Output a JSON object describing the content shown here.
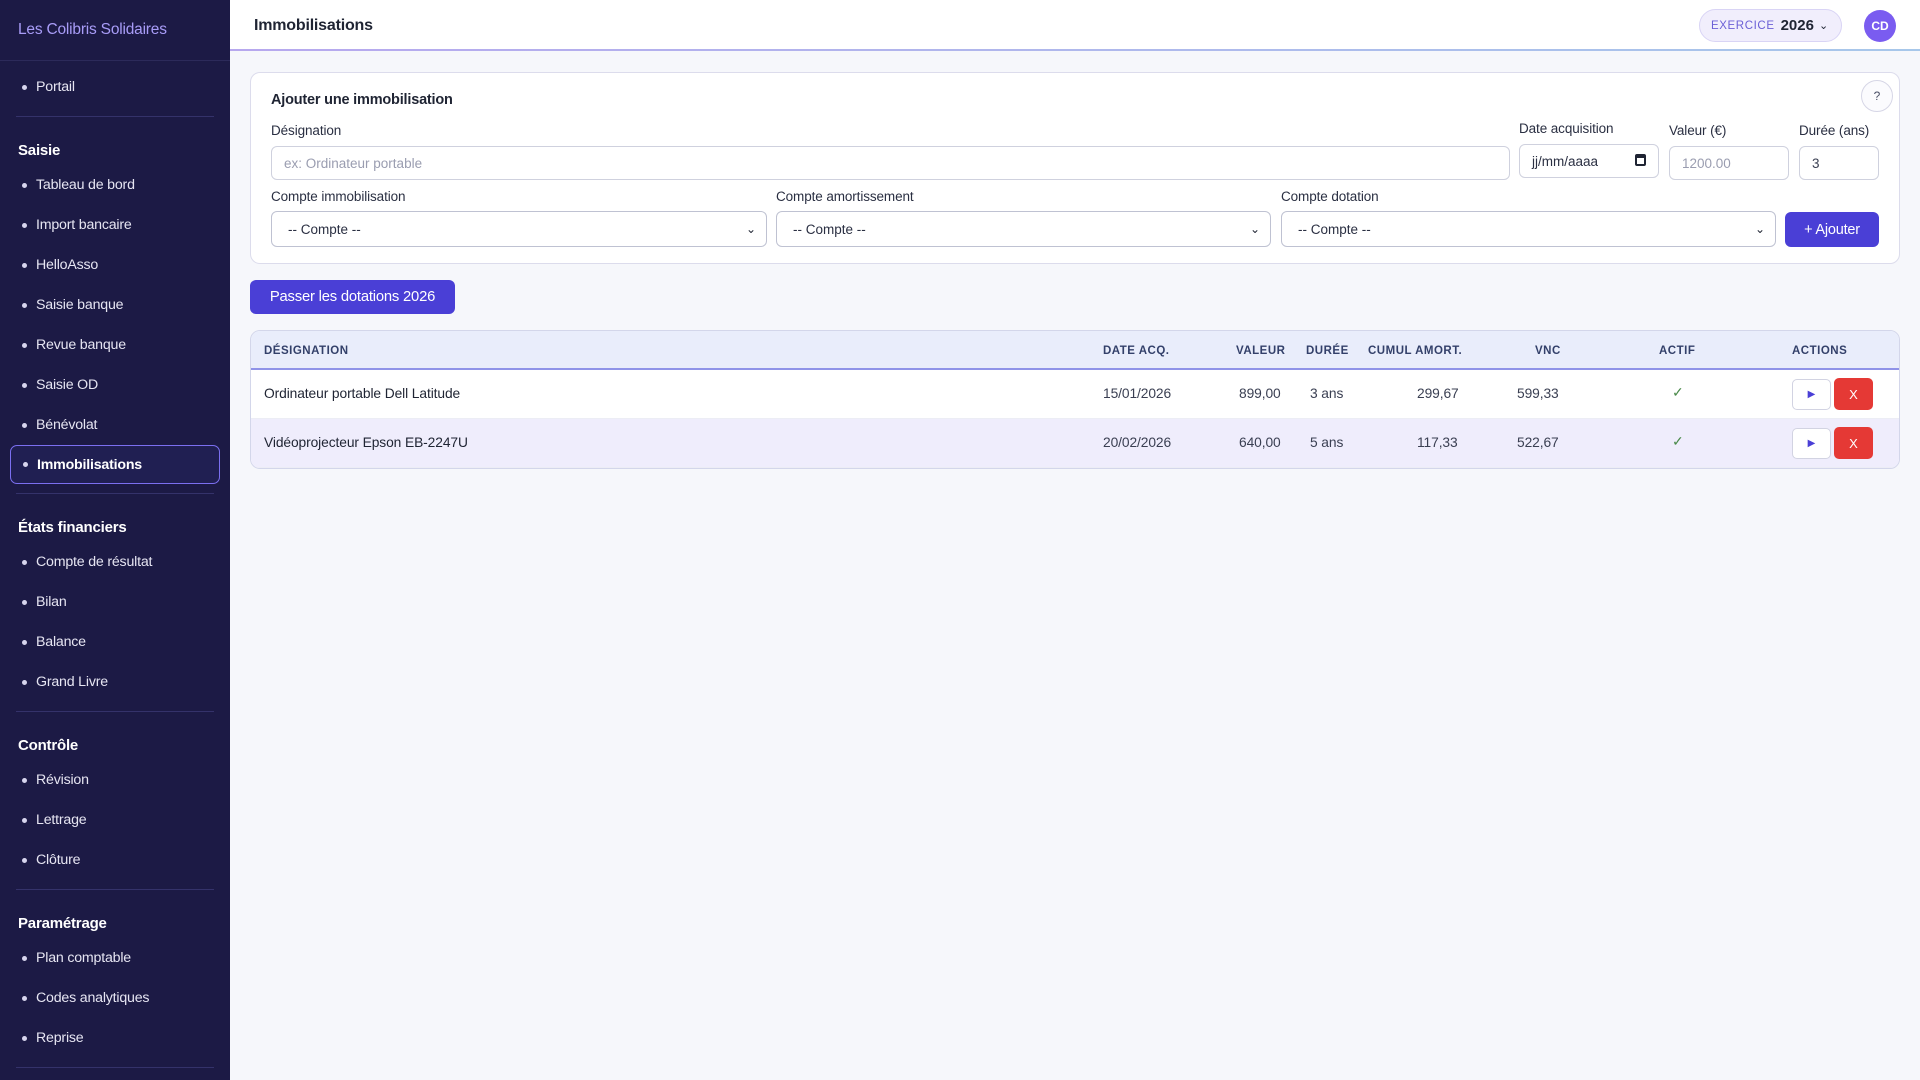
{
  "app": {
    "org_name": "Les Colibris Solidaires"
  },
  "sidebar": {
    "top_items": [
      {
        "label": "Portail"
      }
    ],
    "sections": [
      {
        "title": "Saisie",
        "items": [
          {
            "label": "Tableau de bord"
          },
          {
            "label": "Import bancaire"
          },
          {
            "label": "HelloAsso"
          },
          {
            "label": "Saisie banque"
          },
          {
            "label": "Revue banque"
          },
          {
            "label": "Saisie OD"
          },
          {
            "label": "Bénévolat"
          },
          {
            "label": "Immobilisations",
            "active": true
          }
        ]
      },
      {
        "title": "États financiers",
        "items": [
          {
            "label": "Compte de résultat"
          },
          {
            "label": "Bilan"
          },
          {
            "label": "Balance"
          },
          {
            "label": "Grand Livre"
          }
        ]
      },
      {
        "title": "Contrôle",
        "items": [
          {
            "label": "Révision"
          },
          {
            "label": "Lettrage"
          },
          {
            "label": "Clôture"
          }
        ]
      },
      {
        "title": "Paramétrage",
        "items": [
          {
            "label": "Plan comptable"
          },
          {
            "label": "Codes analytiques"
          },
          {
            "label": "Reprise"
          }
        ]
      }
    ]
  },
  "header": {
    "title": "Immobilisations",
    "exercice_label": "EXERCICE",
    "exercice_year": "2026",
    "avatar_initials": "CD"
  },
  "form": {
    "title": "Ajouter une immobilisation",
    "help_label": "?",
    "designation": {
      "label": "Désignation",
      "placeholder": "ex: Ordinateur portable"
    },
    "date": {
      "label": "Date acquisition",
      "placeholder": "jj/mm/aaaa"
    },
    "valeur": {
      "label": "Valeur (€)",
      "placeholder": "1200.00"
    },
    "duree": {
      "label": "Durée (ans)",
      "value": "3"
    },
    "compte_immo": {
      "label": "Compte immobilisation",
      "selected": "-- Compte --"
    },
    "compte_amort": {
      "label": "Compte amortissement",
      "selected": "-- Compte --"
    },
    "compte_dotation": {
      "label": "Compte dotation",
      "selected": "-- Compte --"
    },
    "add_label": "+ Ajouter"
  },
  "dotations_button": "Passer les dotations 2026",
  "table": {
    "headers": {
      "designation": "DÉSIGNATION",
      "date": "DATE ACQ.",
      "valeur": "VALEUR",
      "duree": "DURÉE",
      "cumul": "CUMUL AMORT.",
      "vnc": "VNC",
      "actif": "ACTIF",
      "actions": "ACTIONS"
    },
    "rows": [
      {
        "designation": "Ordinateur portable Dell Latitude",
        "date": "15/01/2026",
        "valeur": "899,00",
        "duree": "3 ans",
        "cumul": "299,67",
        "vnc": "599,33",
        "actif": "✓",
        "play": "▶",
        "delete": "X"
      },
      {
        "designation": "Vidéoprojecteur Epson EB-2247U",
        "date": "20/02/2026",
        "valeur": "640,00",
        "duree": "5 ans",
        "cumul": "117,33",
        "vnc": "522,67",
        "actif": "✓",
        "play": "▶",
        "delete": "X"
      }
    ]
  },
  "colors": {
    "sidebar_bg": "#1c1a45",
    "accent": "#4a3fd6",
    "danger": "#e53935",
    "brand_text": "#a89cf7"
  }
}
